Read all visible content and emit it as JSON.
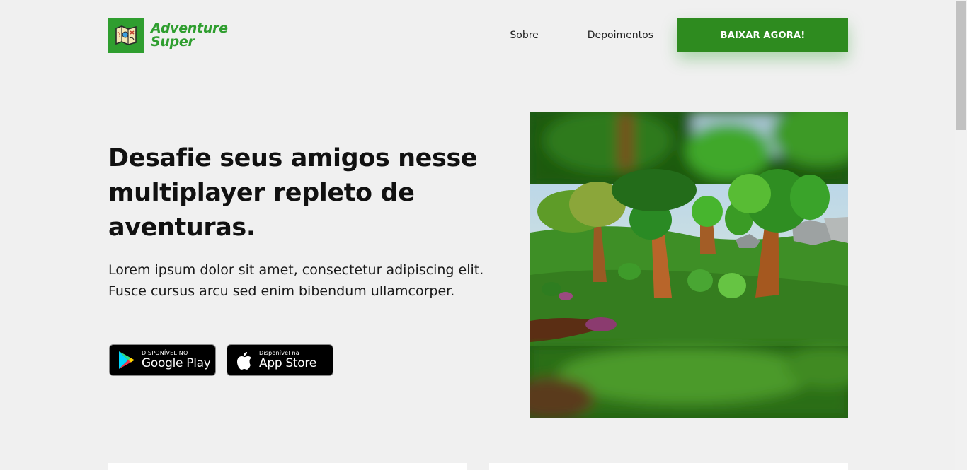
{
  "header": {
    "logo_line1": "Adventure",
    "logo_line2": "Super",
    "logo_icon": "map-icon",
    "nav": {
      "sobre": "Sobre",
      "depoimentos": "Depoimentos",
      "cta": "BAIXAR AGORA!"
    }
  },
  "hero": {
    "title": "Desafie seus amigos nesse multiplayer repleto de aventuras.",
    "description": "Lorem ipsum dolor sit amet, consectetur adipiscing elit. Fusce cursus arcu sed enim bibendum ullamcorper.",
    "google_play": {
      "small": "DISPONÍVEL NO",
      "big": "Google Play",
      "icon": "google-play-icon"
    },
    "app_store": {
      "small": "Disponível na",
      "big": "App Store",
      "icon": "apple-icon"
    }
  },
  "colors": {
    "accent": "#2f9e2f",
    "cta": "#2e8b1f",
    "background": "#f0f0f0"
  }
}
